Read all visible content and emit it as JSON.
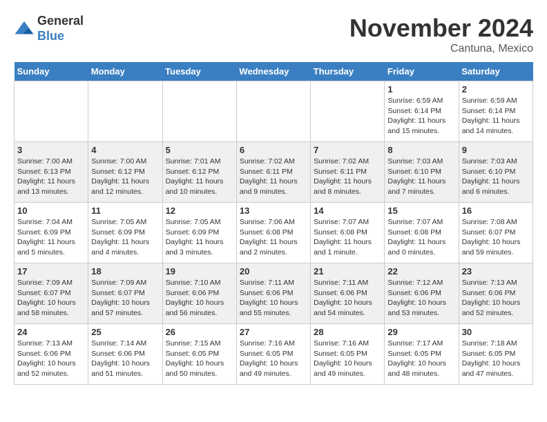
{
  "header": {
    "logo_line1": "General",
    "logo_line2": "Blue",
    "month": "November 2024",
    "location": "Cantuna, Mexico"
  },
  "days_of_week": [
    "Sunday",
    "Monday",
    "Tuesday",
    "Wednesday",
    "Thursday",
    "Friday",
    "Saturday"
  ],
  "weeks": [
    [
      {
        "day": "",
        "info": ""
      },
      {
        "day": "",
        "info": ""
      },
      {
        "day": "",
        "info": ""
      },
      {
        "day": "",
        "info": ""
      },
      {
        "day": "",
        "info": ""
      },
      {
        "day": "1",
        "info": "Sunrise: 6:59 AM\nSunset: 6:14 PM\nDaylight: 11 hours\nand 15 minutes."
      },
      {
        "day": "2",
        "info": "Sunrise: 6:59 AM\nSunset: 6:14 PM\nDaylight: 11 hours\nand 14 minutes."
      }
    ],
    [
      {
        "day": "3",
        "info": "Sunrise: 7:00 AM\nSunset: 6:13 PM\nDaylight: 11 hours\nand 13 minutes."
      },
      {
        "day": "4",
        "info": "Sunrise: 7:00 AM\nSunset: 6:12 PM\nDaylight: 11 hours\nand 12 minutes."
      },
      {
        "day": "5",
        "info": "Sunrise: 7:01 AM\nSunset: 6:12 PM\nDaylight: 11 hours\nand 10 minutes."
      },
      {
        "day": "6",
        "info": "Sunrise: 7:02 AM\nSunset: 6:11 PM\nDaylight: 11 hours\nand 9 minutes."
      },
      {
        "day": "7",
        "info": "Sunrise: 7:02 AM\nSunset: 6:11 PM\nDaylight: 11 hours\nand 8 minutes."
      },
      {
        "day": "8",
        "info": "Sunrise: 7:03 AM\nSunset: 6:10 PM\nDaylight: 11 hours\nand 7 minutes."
      },
      {
        "day": "9",
        "info": "Sunrise: 7:03 AM\nSunset: 6:10 PM\nDaylight: 11 hours\nand 6 minutes."
      }
    ],
    [
      {
        "day": "10",
        "info": "Sunrise: 7:04 AM\nSunset: 6:09 PM\nDaylight: 11 hours\nand 5 minutes."
      },
      {
        "day": "11",
        "info": "Sunrise: 7:05 AM\nSunset: 6:09 PM\nDaylight: 11 hours\nand 4 minutes."
      },
      {
        "day": "12",
        "info": "Sunrise: 7:05 AM\nSunset: 6:09 PM\nDaylight: 11 hours\nand 3 minutes."
      },
      {
        "day": "13",
        "info": "Sunrise: 7:06 AM\nSunset: 6:08 PM\nDaylight: 11 hours\nand 2 minutes."
      },
      {
        "day": "14",
        "info": "Sunrise: 7:07 AM\nSunset: 6:08 PM\nDaylight: 11 hours\nand 1 minute."
      },
      {
        "day": "15",
        "info": "Sunrise: 7:07 AM\nSunset: 6:08 PM\nDaylight: 11 hours\nand 0 minutes."
      },
      {
        "day": "16",
        "info": "Sunrise: 7:08 AM\nSunset: 6:07 PM\nDaylight: 10 hours\nand 59 minutes."
      }
    ],
    [
      {
        "day": "17",
        "info": "Sunrise: 7:09 AM\nSunset: 6:07 PM\nDaylight: 10 hours\nand 58 minutes."
      },
      {
        "day": "18",
        "info": "Sunrise: 7:09 AM\nSunset: 6:07 PM\nDaylight: 10 hours\nand 57 minutes."
      },
      {
        "day": "19",
        "info": "Sunrise: 7:10 AM\nSunset: 6:06 PM\nDaylight: 10 hours\nand 56 minutes."
      },
      {
        "day": "20",
        "info": "Sunrise: 7:11 AM\nSunset: 6:06 PM\nDaylight: 10 hours\nand 55 minutes."
      },
      {
        "day": "21",
        "info": "Sunrise: 7:11 AM\nSunset: 6:06 PM\nDaylight: 10 hours\nand 54 minutes."
      },
      {
        "day": "22",
        "info": "Sunrise: 7:12 AM\nSunset: 6:06 PM\nDaylight: 10 hours\nand 53 minutes."
      },
      {
        "day": "23",
        "info": "Sunrise: 7:13 AM\nSunset: 6:06 PM\nDaylight: 10 hours\nand 52 minutes."
      }
    ],
    [
      {
        "day": "24",
        "info": "Sunrise: 7:13 AM\nSunset: 6:06 PM\nDaylight: 10 hours\nand 52 minutes."
      },
      {
        "day": "25",
        "info": "Sunrise: 7:14 AM\nSunset: 6:06 PM\nDaylight: 10 hours\nand 51 minutes."
      },
      {
        "day": "26",
        "info": "Sunrise: 7:15 AM\nSunset: 6:05 PM\nDaylight: 10 hours\nand 50 minutes."
      },
      {
        "day": "27",
        "info": "Sunrise: 7:16 AM\nSunset: 6:05 PM\nDaylight: 10 hours\nand 49 minutes."
      },
      {
        "day": "28",
        "info": "Sunrise: 7:16 AM\nSunset: 6:05 PM\nDaylight: 10 hours\nand 49 minutes."
      },
      {
        "day": "29",
        "info": "Sunrise: 7:17 AM\nSunset: 6:05 PM\nDaylight: 10 hours\nand 48 minutes."
      },
      {
        "day": "30",
        "info": "Sunrise: 7:18 AM\nSunset: 6:05 PM\nDaylight: 10 hours\nand 47 minutes."
      }
    ]
  ]
}
